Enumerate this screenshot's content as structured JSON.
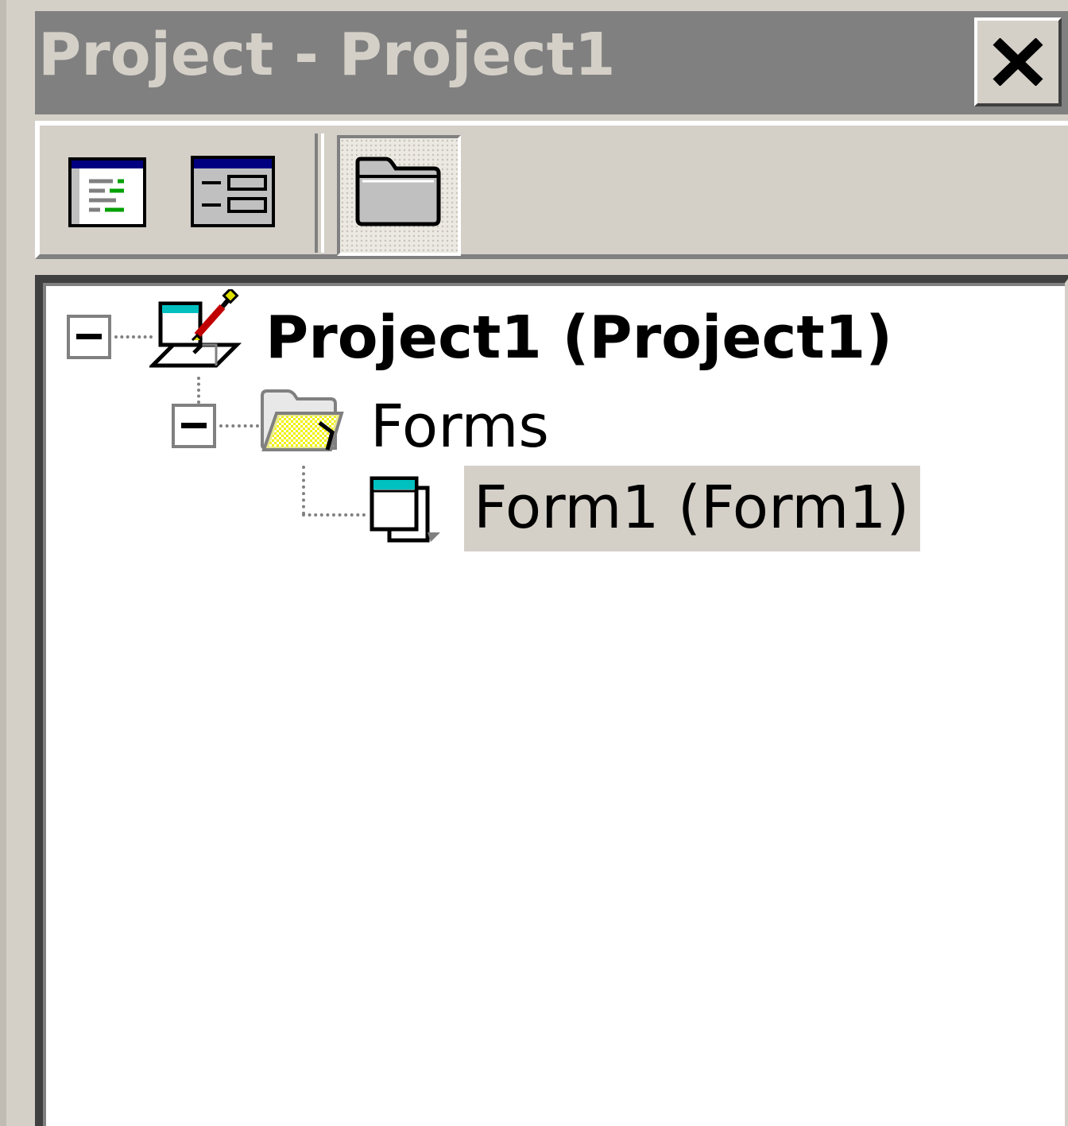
{
  "window": {
    "title": "Project - Project1",
    "close_label": "Close"
  },
  "toolbar": {
    "buttons": [
      {
        "name": "view-code",
        "icon": "view-code-icon"
      },
      {
        "name": "view-object",
        "icon": "view-object-icon"
      },
      {
        "name": "toggle-folders",
        "icon": "folder-icon",
        "pressed": true
      }
    ]
  },
  "tree": {
    "project": {
      "label": "Project1 (Project1)",
      "expanded": true,
      "icon": "project-icon",
      "children": {
        "forms_folder": {
          "label": "Forms",
          "expanded": true,
          "icon": "open-folder-icon",
          "children": [
            {
              "label": "Form1 (Form1)",
              "icon": "form-icon",
              "selected": true
            }
          ]
        }
      }
    }
  },
  "colors": {
    "titlebar_inactive": "#808080",
    "title_text_inactive": "#d4d0c8",
    "face": "#d4d0c8",
    "tree_background": "#ffffff",
    "selection": "#d4d0c8"
  }
}
